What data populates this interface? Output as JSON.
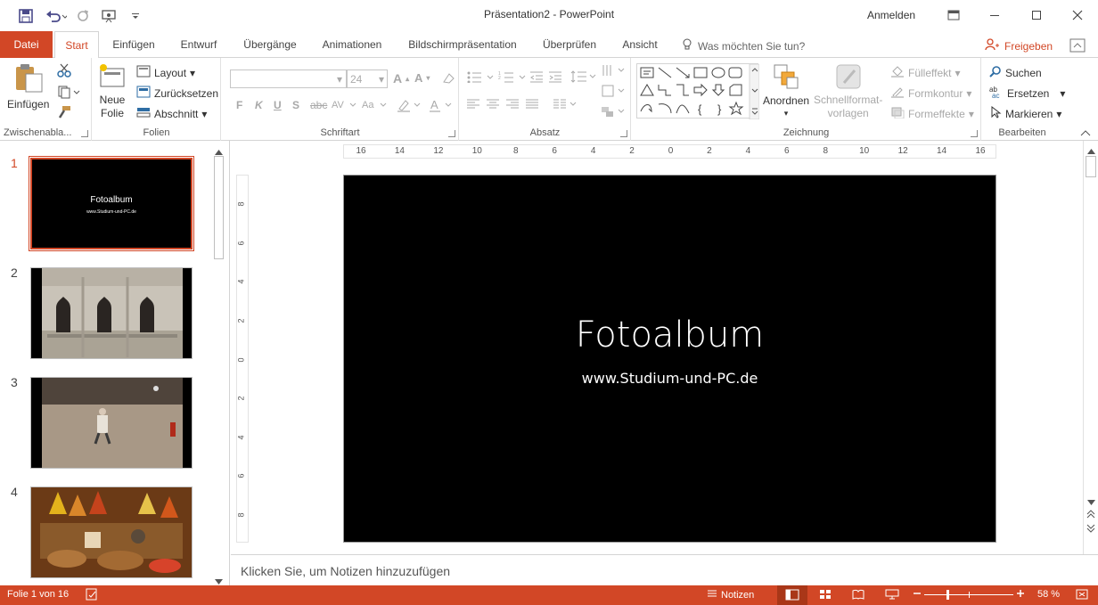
{
  "window": {
    "title": "Präsentation2  -  PowerPoint",
    "signin": "Anmelden",
    "accent": "#d24726"
  },
  "qat": {
    "icons": [
      "save-icon",
      "undo-icon",
      "redo-icon",
      "presenter-icon",
      "customize-qat-icon"
    ]
  },
  "tabs": [
    {
      "label": "Datei"
    },
    {
      "label": "Start"
    },
    {
      "label": "Einfügen"
    },
    {
      "label": "Entwurf"
    },
    {
      "label": "Übergänge"
    },
    {
      "label": "Animationen"
    },
    {
      "label": "Bildschirmpräsentation"
    },
    {
      "label": "Überprüfen"
    },
    {
      "label": "Ansicht"
    }
  ],
  "tellme": "Was möchten Sie tun?",
  "share": "Freigeben",
  "ribbon": {
    "clipboard": {
      "paste": "Einfügen",
      "label": "Zwischenabla..."
    },
    "slides": {
      "new_slide_1": "Neue",
      "new_slide_2": "Folie",
      "layout": "Layout",
      "reset": "Zurücksetzen",
      "section": "Abschnitt",
      "label": "Folien"
    },
    "font": {
      "size": "24",
      "bold": "F",
      "italic": "K",
      "underline": "U",
      "shadow": "S",
      "strike": "abc",
      "label": "Schriftart"
    },
    "paragraph": {
      "label": "Absatz"
    },
    "drawing": {
      "arrange": "Anordnen",
      "quickstyles_1": "Schnellformat-",
      "quickstyles_2": "vorlagen",
      "fill": "Fülleffekt",
      "outline": "Formkontur",
      "effects": "Formeffekte",
      "label": "Zeichnung"
    },
    "editing": {
      "find": "Suchen",
      "replace": "Ersetzen",
      "select": "Markieren",
      "label": "Bearbeiten"
    }
  },
  "slides": [
    {
      "number": "1",
      "title": "Fotoalbum",
      "subtitle": "www.Studium-und-PC.de"
    },
    {
      "number": "2"
    },
    {
      "number": "3"
    },
    {
      "number": "4"
    }
  ],
  "ruler": {
    "h": [
      "16",
      "14",
      "12",
      "10",
      "8",
      "6",
      "4",
      "2",
      "0",
      "2",
      "4",
      "6",
      "8",
      "10",
      "12",
      "14",
      "16"
    ],
    "v": [
      "8",
      "6",
      "4",
      "2",
      "0",
      "2",
      "4",
      "6",
      "8"
    ]
  },
  "slide": {
    "title": "Fotoalbum",
    "subtitle": "www.Studium-und-PC.de"
  },
  "notes": {
    "placeholder": "Klicken Sie, um Notizen hinzuzufügen"
  },
  "status": {
    "slide_info": "Folie 1 von 16",
    "notes": "Notizen",
    "zoom": "58 %",
    "zoom_level_percent": 58
  }
}
